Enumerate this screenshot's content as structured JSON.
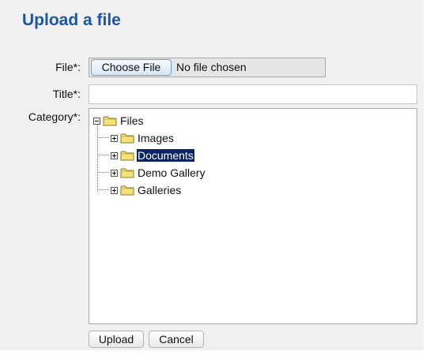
{
  "page_title": "Upload a file",
  "form": {
    "file_label": "File*:",
    "choose_file_button": "Choose File",
    "no_file_text": "No file chosen",
    "title_label": "Title*:",
    "title_value": "",
    "category_label": "Category*:"
  },
  "tree": {
    "root": {
      "label": "Files",
      "expanded": true,
      "icon": "folder-icon"
    },
    "children": [
      {
        "label": "Images",
        "expanded": false,
        "selected": false,
        "icon": "folder-icon"
      },
      {
        "label": "Documents",
        "expanded": false,
        "selected": true,
        "icon": "folder-icon"
      },
      {
        "label": "Demo Gallery",
        "expanded": false,
        "selected": false,
        "icon": "folder-icon"
      },
      {
        "label": "Galleries",
        "expanded": false,
        "selected": false,
        "icon": "folder-icon"
      }
    ]
  },
  "actions": {
    "upload_label": "Upload",
    "cancel_label": "Cancel"
  },
  "colors": {
    "title": "#1c56a6",
    "selection_bg": "#0a2466",
    "selection_fg": "#ffffff",
    "panel_bg": "#f0f0f0",
    "folder_fill": "#f5e27a"
  }
}
